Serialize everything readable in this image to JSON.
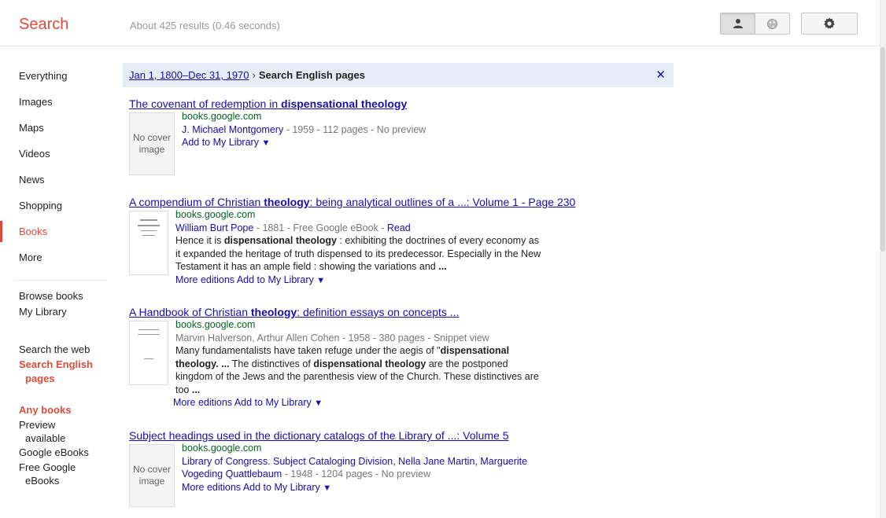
{
  "header": {
    "logo": "Search",
    "stats": "About 425 results (0.46 seconds)"
  },
  "sidebar": {
    "nav": [
      {
        "label": "Everything",
        "active": false
      },
      {
        "label": "Images",
        "active": false
      },
      {
        "label": "Maps",
        "active": false
      },
      {
        "label": "Videos",
        "active": false
      },
      {
        "label": "News",
        "active": false
      },
      {
        "label": "Shopping",
        "active": false
      },
      {
        "label": "Books",
        "active": true
      },
      {
        "label": "More",
        "active": false
      }
    ],
    "browse_books": "Browse books",
    "my_library": "My Library",
    "search_web": "Search the web",
    "search_english_1": "Search English",
    "search_english_2": "pages",
    "any_books": "Any books",
    "preview_1": "Preview",
    "preview_2": "available",
    "google_ebooks": "Google eBooks",
    "free_1": "Free Google",
    "free_2": "eBooks"
  },
  "filter": {
    "date_range": "Jan 1, 1800–Dec 31, 1970",
    "separator": "›",
    "current": "Search English pages",
    "close": "✕"
  },
  "results": [
    {
      "title_pre": "The covenant of redemption in ",
      "title_bold": "dispensational theology",
      "title_post": "",
      "thumb_1": "No cover",
      "thumb_2": "image",
      "url": "books.google.com",
      "author": "J. Michael Montgomery",
      "meta": " - 1959 - 112 pages - No preview",
      "action": "Add to My Library"
    },
    {
      "title_pre": "A compendium of Christian ",
      "title_bold": "theology",
      "title_post": ": being analytical outlines of a ...: Volume 1 - Page 230",
      "url": "books.google.com",
      "author": "William Burt Pope",
      "meta": " - 1881 - Free Google eBook - ",
      "read": "Read",
      "snip_1a": "Hence it is ",
      "snip_1b": "dispensational theology",
      "snip_1c": " : exhibiting the doctrines of every economy as",
      "snip_2": "it expanded the heritage of truth dispensed to its predecessor. Especially in the New",
      "snip_3a": "Testament it has an ample field : showing the variations and ",
      "snip_3b": "...",
      "more_editions": "More editions",
      "action": "Add to My Library"
    },
    {
      "title_pre": "A Handbook of Christian ",
      "title_bold": "theology",
      "title_post": ": definition essays on concepts ...",
      "url": "books.google.com",
      "meta": "Marvin Halverson, Arthur Allen Cohen - 1958 - 380 pages - Snippet view",
      "snip_1a": "Many fundamentalists have taken refuge under the aegis of \"",
      "snip_1b": "dispensational",
      "snip_2a": "theology",
      "snip_2b": ". ...",
      "snip_2c": " The distinctives of ",
      "snip_2d": "dispensational theology",
      "snip_2e": " are the postponed",
      "snip_3": "kingdom of the Jews and the parenthesis view of the Church. These distinctives are",
      "snip_4a": "too ",
      "snip_4b": "...",
      "more_editions": "More editions",
      "action": "Add to My Library"
    },
    {
      "title_full": "Subject headings used in the dictionary catalogs of the Library of ...: Volume 5",
      "thumb_1": "No cover",
      "thumb_2": "image",
      "url": "books.google.com",
      "author_1": "Library of Congress. Subject Cataloging Division",
      "author_2": ", Nella Jane Martin, Marguerite",
      "author_3": "Vogeding Quattlebaum",
      "meta": " - 1948 - 1204 pages - No preview",
      "more_editions": "More editions",
      "action": "Add to My Library"
    }
  ],
  "colors": {
    "accent": "#dd4b39",
    "link": "#1a0dab",
    "url": "#006621"
  }
}
